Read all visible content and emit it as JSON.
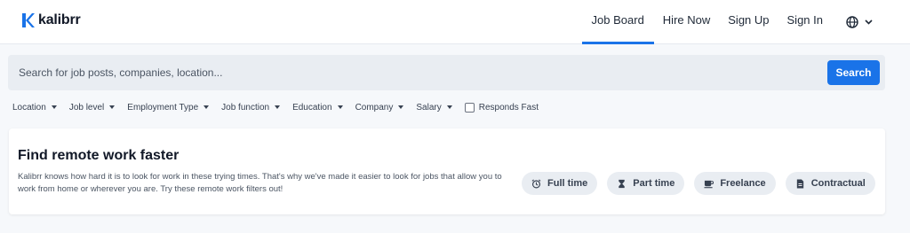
{
  "brand": {
    "name": "kalibrr",
    "color": "#1a73e8"
  },
  "nav": {
    "items": [
      {
        "label": "Job Board",
        "active": true
      },
      {
        "label": "Hire Now",
        "active": false
      },
      {
        "label": "Sign Up",
        "active": false
      },
      {
        "label": "Sign In",
        "active": false
      }
    ],
    "language_icon": "globe-icon"
  },
  "search": {
    "placeholder": "Search for job posts, companies, location...",
    "button_label": "Search"
  },
  "filters": {
    "items": [
      "Location",
      "Job level",
      "Employment Type",
      "Job function",
      "Education",
      "Company",
      "Salary"
    ],
    "checkbox_label": "Responds Fast"
  },
  "remote_card": {
    "title": "Find remote work faster",
    "description": "Kalibrr knows how hard it is to look for work in these trying times. That's why we've made it easier to look for jobs that allow you to work from home or wherever you are. Try these remote work filters out!",
    "chips": [
      {
        "label": "Full time",
        "icon": "alarm-clock-icon"
      },
      {
        "label": "Part time",
        "icon": "hourglass-icon"
      },
      {
        "label": "Freelance",
        "icon": "coffee-cup-icon"
      },
      {
        "label": "Contractual",
        "icon": "document-icon"
      }
    ]
  }
}
